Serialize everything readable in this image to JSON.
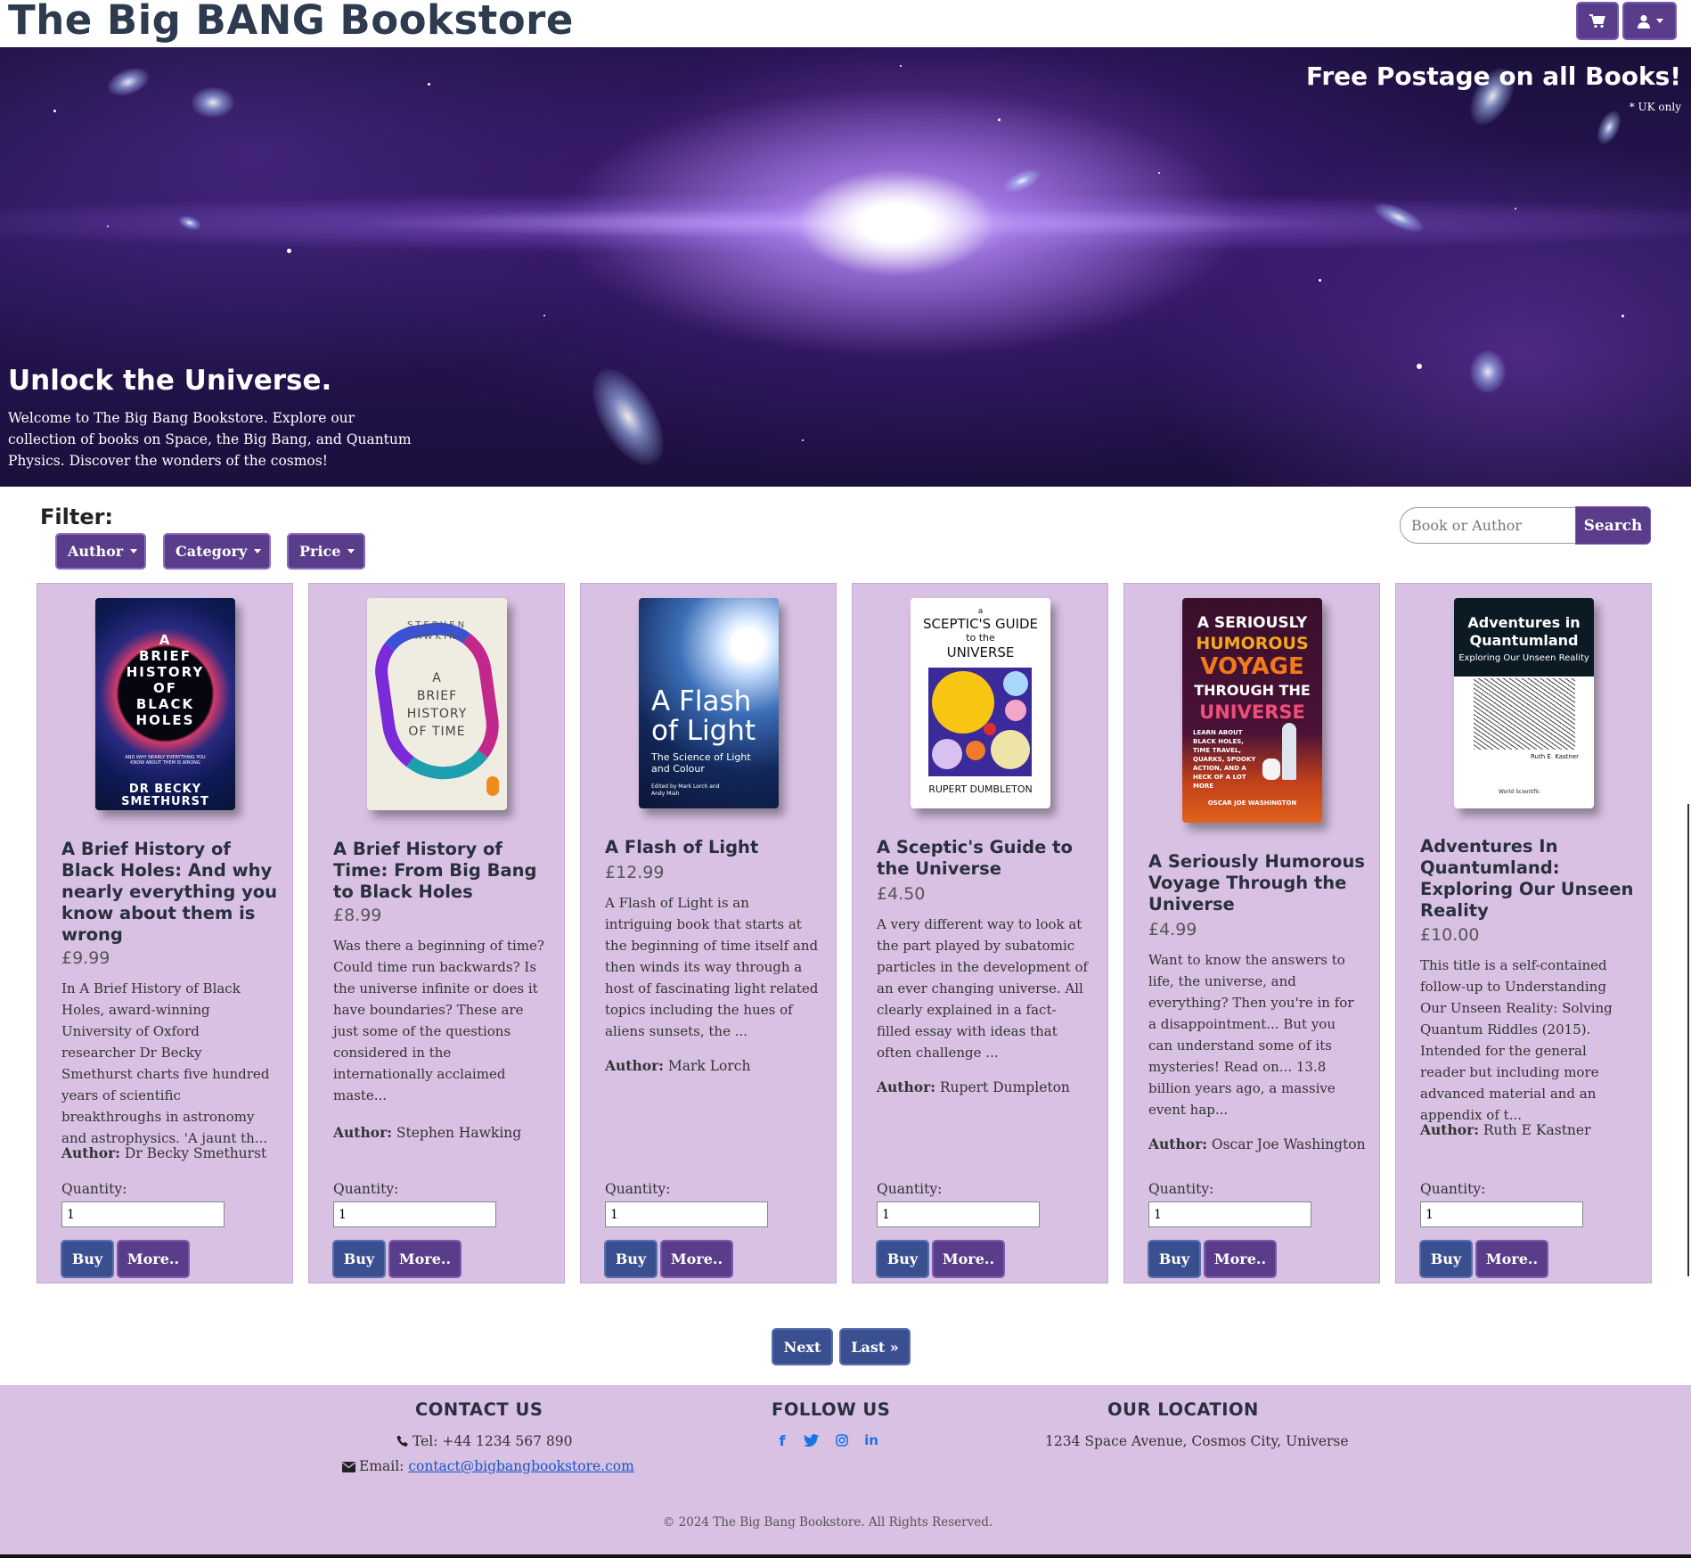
{
  "header": {
    "brand": "The Big BANG Bookstore",
    "cart_icon": "cart-icon",
    "user_icon": "user-icon"
  },
  "hero": {
    "promo": "Free Postage on all Books!",
    "promo_note": "* UK only",
    "title": "Unlock the Universe.",
    "text": "Welcome to The Big Bang Bookstore. Explore our collection of books on Space, the Big Bang, and Quantum Physics. Discover the wonders of the cosmos!"
  },
  "filter": {
    "label": "Filter:",
    "author": "Author",
    "category": "Category",
    "price": "Price"
  },
  "search": {
    "placeholder": "Book or Author",
    "button": "Search"
  },
  "labels": {
    "author": "Author:",
    "quantity": "Quantity:",
    "buy": "Buy",
    "more": "More.."
  },
  "books": [
    {
      "title": "A Brief History of Black Holes: And why nearly everything you know about them is wrong",
      "price": "£9.99",
      "description": "In A Brief History of Black Holes, award-winning University of Oxford researcher Dr Becky Smethurst charts five hundred years of scientific breakthroughs in astronomy and astrophysics. 'A jaunt th...",
      "author": "Dr Becky Smethurst",
      "quantity": "1",
      "cover": {
        "lines": [
          "A",
          "BRIEF",
          "HISTORY",
          "OF",
          "BLACK",
          "HOLES"
        ],
        "sub": "AND WHY NEARLY EVERYTHING YOU KNOW ABOUT THEM IS WRONG",
        "author": "DR BECKY SMETHURST"
      }
    },
    {
      "title": "A Brief History of Time: From Big Bang to Black Holes",
      "price": "£8.99",
      "description": "Was there a beginning of time? Could time run backwards? Is the universe infinite or does it have boundaries? These are just some of the questions considered in the internationally acclaimed maste...",
      "author": "Stephen Hawking",
      "quantity": "1",
      "cover": {
        "top": "STEPHEN HAWKING",
        "lines": [
          "A",
          "BRIEF",
          "HISTORY",
          "OF TIME"
        ]
      }
    },
    {
      "title": "A Flash of Light",
      "price": "£12.99",
      "description": "A Flash of Light is an intriguing book that starts at the beginning of time itself and then winds its way through a host of fascinating light related topics including the hues of aliens sunsets, the ...",
      "author": "Mark Lorch",
      "quantity": "1",
      "cover": {
        "title1": "A Flash",
        "title2": "of Light",
        "sub": "The Science of Light and Colour",
        "editors": "Edited by Mark Lorch and Andy Miah"
      }
    },
    {
      "title": "A Sceptic's Guide to the Universe",
      "price": "£4.50",
      "description": "A very different way to look at the part played by subatomic particles in the development of an ever changing universe. All clearly explained in a fact- filled essay with ideas that often challenge ...",
      "author": "Rupert Dumpleton",
      "quantity": "1",
      "cover": {
        "small": "a",
        "line1": "SCEPTIC'S GUIDE",
        "line2": "to the",
        "line3": "UNIVERSE",
        "author": "RUPERT DUMBLETON"
      }
    },
    {
      "title": "A Seriously Humorous Voyage Through the Universe",
      "price": "£4.99",
      "description": "Want to know the answers to life, the universe, and everything? Then you're in for a disappointment... But you can understand some of its mysteries! Read on... 13.8 billion years ago, a massive event hap...",
      "author": "Oscar Joe Washington",
      "quantity": "1",
      "cover": {
        "line1": "A SERIOUSLY",
        "line2": "HUMOROUS",
        "line3": "VOYAGE",
        "line4": "THROUGH THE",
        "line5": "UNIVERSE",
        "blurb": "LEARN ABOUT BLACK HOLES, TIME TRAVEL, QUARKS, SPOOKY ACTION, AND A HECK OF A LOT MORE",
        "author": "OSCAR JOE WASHINGTON"
      }
    },
    {
      "title": "Adventures In Quantumland: Exploring Our Unseen Reality",
      "price": "£10.00",
      "description": "This title is a self-contained follow-up to Understanding Our Unseen Reality: Solving Quantum Riddles (2015). Intended for the general reader but including more advanced material and an appendix of t...",
      "author": "Ruth E Kastner",
      "quantity": "1",
      "cover": {
        "title1": "Adventures in",
        "title2": "Quantumland",
        "sub": "Exploring Our Unseen Reality",
        "author": "Ruth E. Kastner",
        "publisher": "World Scientific"
      }
    }
  ],
  "pager": {
    "next": "Next",
    "last": "Last »"
  },
  "footer": {
    "contact_heading": "CONTACT US",
    "tel": "Tel: +44 1234 567 890",
    "email_label": "Email:",
    "email": "contact@bigbangbookstore.com",
    "follow_heading": "FOLLOW US",
    "social": [
      "facebook-icon",
      "twitter-icon",
      "instagram-icon",
      "linkedin-icon"
    ],
    "location_heading": "OUR LOCATION",
    "address": "1234 Space Avenue, Cosmos City, Universe",
    "copyright": "© 2024 The Big Bang Bookstore. All Rights Reserved."
  },
  "colors": {
    "brand_purple": "#5a3d8a",
    "buy_blue": "#3a4f8f",
    "card_lilac": "#d8c1e3",
    "link_blue": "#1a56c8"
  }
}
